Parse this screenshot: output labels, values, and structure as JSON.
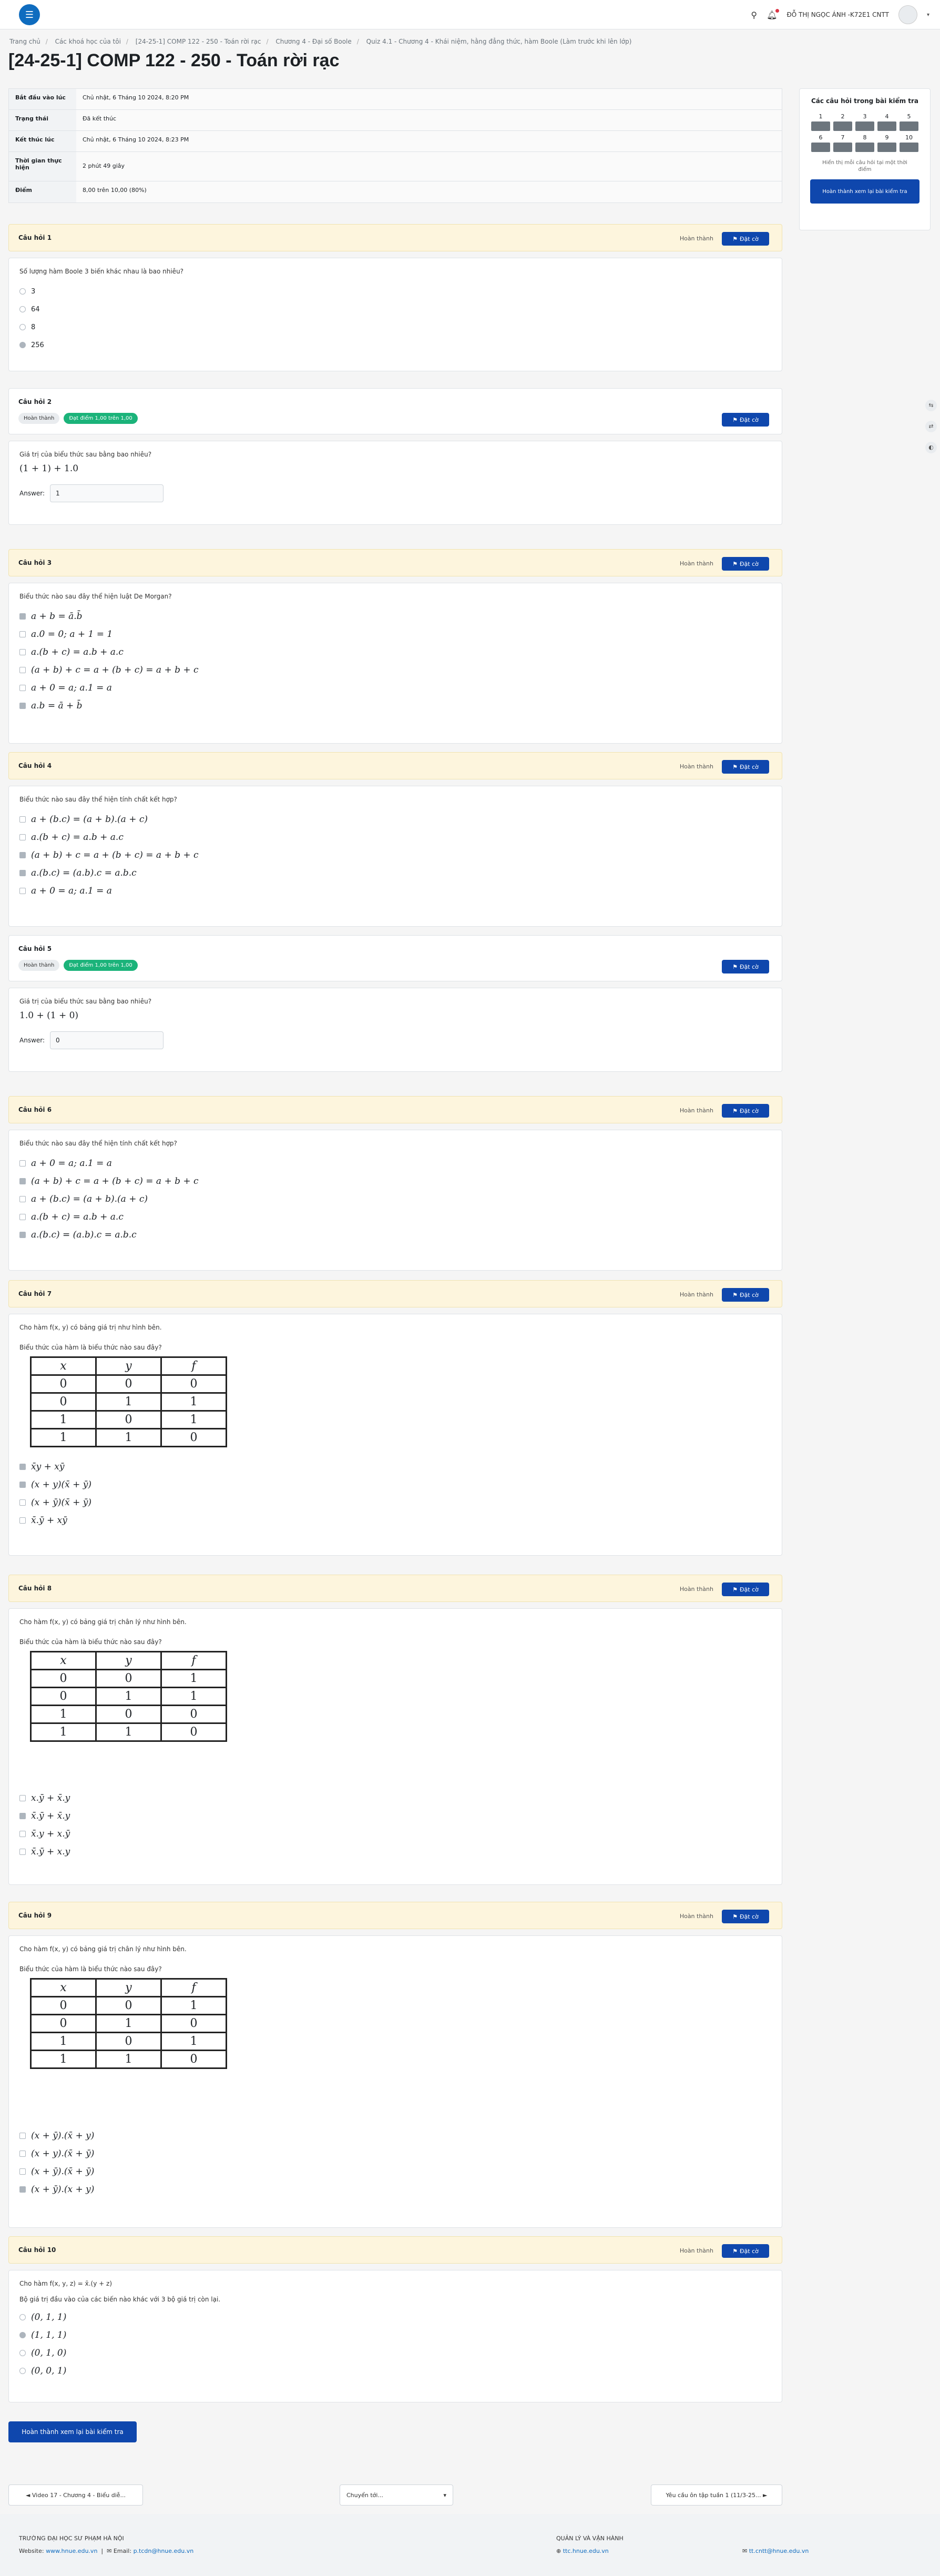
{
  "header": {
    "user": "ĐỖ THỊ NGỌC ÁNH -K72E1 CNTT",
    "logo_icon": "hamburger-menu-icon"
  },
  "breadcrumbs": [
    "Trang chủ",
    "Các khoá học của tôi",
    "[24-25-1] COMP 122 - 250 - Toán rời rạc",
    "Chương 4 - Đại số Boole",
    "Quiz 4.1 - Chương 4 - Khái niệm, hằng đẳng thức, hàm Boole (Làm trước khi lên lớp)"
  ],
  "title": "[24-25-1] COMP 122 - 250 - Toán rời rạc",
  "summary": [
    {
      "k": "Bắt đầu vào lúc",
      "v": "Chủ nhật, 6 Tháng 10 2024, 8:20 PM"
    },
    {
      "k": "Trạng thái",
      "v": "Đã kết thúc"
    },
    {
      "k": "Kết thúc lúc",
      "v": "Chủ nhật, 6 Tháng 10 2024, 8:23 PM"
    },
    {
      "k": "Thời gian thực hiện",
      "v": "2 phút 49 giây"
    },
    {
      "k": "Điểm",
      "v": "8,00 trên 10,00 (80%)"
    }
  ],
  "state_done": "Hoàn thành",
  "flag_label": "Đặt cờ",
  "badge_points": "Đạt điểm 1,00 trên 1,00",
  "answer_label": "Answer:",
  "q1": {
    "title": "Câu hỏi 1",
    "text": "Số lượng hàm Boole 3 biến khác nhau là bao nhiêu?",
    "opts": [
      "3",
      "64",
      "8",
      "256"
    ]
  },
  "q2": {
    "title": "Câu hỏi 2",
    "text": "Giá trị của biểu thức sau bằng bao nhiêu?",
    "expr": "(1 + 1) + 1.0",
    "answer": "1"
  },
  "q3": {
    "title": "Câu hỏi 3",
    "text": "Biểu thức nào sau đây thể hiện luật De Morgan?",
    "opts": [
      "a + b = ā.b̄",
      "a.0 = 0; a + 1 = 1",
      "a.(b + c) = a.b + a.c",
      "(a + b) + c = a + (b + c) = a + b + c",
      "a + 0 = a; a.1 = a",
      "a.b = ā + b̄"
    ]
  },
  "q4": {
    "title": "Câu hỏi 4",
    "text": "Biểu thức nào sau đây thể hiện tính chất kết hợp?",
    "opts": [
      "a + (b.c) = (a + b).(a + c)",
      "a.(b + c) = a.b + a.c",
      "(a + b) + c = a + (b + c) = a + b + c",
      "a.(b.c) = (a.b).c = a.b.c",
      "a + 0 = a; a.1 = a"
    ]
  },
  "q5": {
    "title": "Câu hỏi 5",
    "text": "Giá trị của biểu thức sau bằng bao nhiêu?",
    "expr": "1.0 + (1 + 0)",
    "answer": "0"
  },
  "q6": {
    "title": "Câu hỏi 6",
    "text": "Biểu thức nào sau đây thể hiện tính chất kết hợp?",
    "opts": [
      "a + 0 = a; a.1 = a",
      "(a + b) + c = a + (b + c) = a + b + c",
      "a + (b.c) = (a + b).(a + c)",
      "a.(b + c) = a.b + a.c",
      "a.(b.c) = (a.b).c = a.b.c"
    ]
  },
  "q7": {
    "title": "Câu hỏi 7",
    "text": "Cho hàm f(x, y) có bảng giá trị như hình bên.",
    "text2": "Biểu thức của hàm là biểu thức nào sau đây?",
    "table": [
      [
        "x",
        "y",
        "f"
      ],
      [
        "0",
        "0",
        "0"
      ],
      [
        "0",
        "1",
        "1"
      ],
      [
        "1",
        "0",
        "1"
      ],
      [
        "1",
        "1",
        "0"
      ]
    ],
    "opts": [
      "x̄y + xȳ",
      "(x + y)(x̄ + ȳ)",
      "(x + ȳ)(x̄ + ȳ)",
      "x̄.ȳ + xȳ"
    ]
  },
  "q8": {
    "title": "Câu hỏi 8",
    "text": "Cho hàm f(x, y) có bảng giá trị chân lý như hình bên.",
    "text2": "Biểu thức của hàm là biểu thức nào sau đây?",
    "table": [
      [
        "x",
        "y",
        "f"
      ],
      [
        "0",
        "0",
        "1"
      ],
      [
        "0",
        "1",
        "1"
      ],
      [
        "1",
        "0",
        "0"
      ],
      [
        "1",
        "1",
        "0"
      ]
    ],
    "opts": [
      "x.ȳ + x̄.y",
      "x̄.ȳ + x̄.y",
      "x̄.y + x.ȳ",
      "x̄.ȳ + x.y"
    ]
  },
  "q9": {
    "title": "Câu hỏi 9",
    "text": "Cho hàm f(x, y) có bảng giá trị chân lý như hình bên.",
    "text2": "Biểu thức của hàm là biểu thức nào sau đây?",
    "table": [
      [
        "x",
        "y",
        "f"
      ],
      [
        "0",
        "0",
        "1"
      ],
      [
        "0",
        "1",
        "0"
      ],
      [
        "1",
        "0",
        "1"
      ],
      [
        "1",
        "1",
        "0"
      ]
    ],
    "opts": [
      "(x + ȳ).(x̄ + y)",
      "(x + y).(x̄ + ȳ)",
      "(x + ȳ).(x̄ + ȳ)",
      "(x + ȳ).(x + y)"
    ]
  },
  "q10": {
    "title": "Câu hỏi 10",
    "text": "Cho hàm f(x, y, z) = x̄.(y + z)",
    "text2": "Bộ giá trị đầu vào của các biến nào khác với 3 bộ giá trị còn lại.",
    "opts": [
      "(0, 1, 1)",
      "(1, 1, 1)",
      "(0, 1, 0)",
      "(0, 0, 1)"
    ]
  },
  "sidebar": {
    "title": "Các câu hỏi trong bài kiểm tra",
    "nums": [
      "1",
      "2",
      "3",
      "4",
      "5",
      "6",
      "7",
      "8",
      "9",
      "10"
    ],
    "note": "Hiển thị mỗi câu hỏi tại một thời điểm",
    "button": "Hoàn thành xem lại bài kiểm tra"
  },
  "end_button": "Hoàn thành xem lại bài kiểm tra",
  "pager": {
    "prev": "◄ Video 17 - Chương 4 - Biểu diễ...",
    "jump": "Chuyển tới...",
    "next": "Yêu cầu ôn tập tuần 1 (11/3-25... ►"
  },
  "footer": {
    "school": "TRƯỜNG ĐẠI HỌC SƯ PHẠM HÀ NỘI",
    "website_label": "Website:",
    "website": "www.hnue.edu.vn",
    "email_label": "Email:",
    "email": "p.tcdn@hnue.edu.vn",
    "admin": "QUẢN LÝ VÀ VẬN HÀNH",
    "admin_site": "ttc.hnue.edu.vn",
    "admin_email": "tt.cntt@hnue.edu.vn"
  }
}
